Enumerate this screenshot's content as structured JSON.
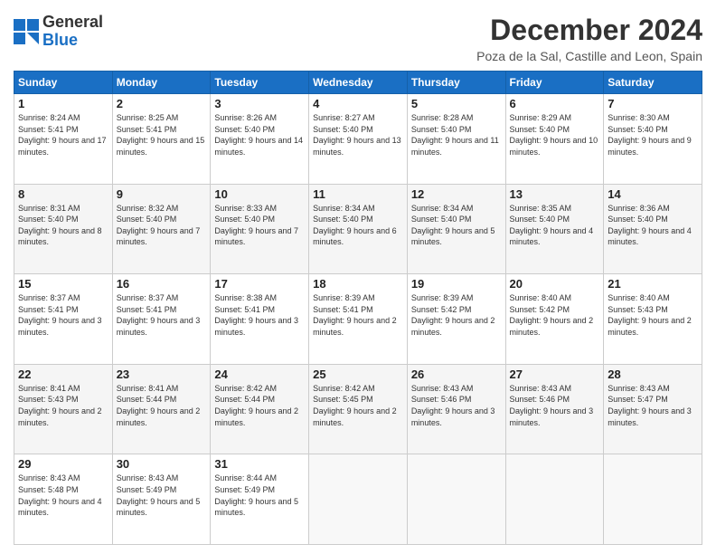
{
  "header": {
    "logo_line1": "General",
    "logo_line2": "Blue",
    "month": "December 2024",
    "location": "Poza de la Sal, Castille and Leon, Spain"
  },
  "days_of_week": [
    "Sunday",
    "Monday",
    "Tuesday",
    "Wednesday",
    "Thursday",
    "Friday",
    "Saturday"
  ],
  "weeks": [
    [
      {
        "day": "1",
        "info": "Sunrise: 8:24 AM\nSunset: 5:41 PM\nDaylight: 9 hours and 17 minutes."
      },
      {
        "day": "2",
        "info": "Sunrise: 8:25 AM\nSunset: 5:41 PM\nDaylight: 9 hours and 15 minutes."
      },
      {
        "day": "3",
        "info": "Sunrise: 8:26 AM\nSunset: 5:40 PM\nDaylight: 9 hours and 14 minutes."
      },
      {
        "day": "4",
        "info": "Sunrise: 8:27 AM\nSunset: 5:40 PM\nDaylight: 9 hours and 13 minutes."
      },
      {
        "day": "5",
        "info": "Sunrise: 8:28 AM\nSunset: 5:40 PM\nDaylight: 9 hours and 11 minutes."
      },
      {
        "day": "6",
        "info": "Sunrise: 8:29 AM\nSunset: 5:40 PM\nDaylight: 9 hours and 10 minutes."
      },
      {
        "day": "7",
        "info": "Sunrise: 8:30 AM\nSunset: 5:40 PM\nDaylight: 9 hours and 9 minutes."
      }
    ],
    [
      {
        "day": "8",
        "info": "Sunrise: 8:31 AM\nSunset: 5:40 PM\nDaylight: 9 hours and 8 minutes."
      },
      {
        "day": "9",
        "info": "Sunrise: 8:32 AM\nSunset: 5:40 PM\nDaylight: 9 hours and 7 minutes."
      },
      {
        "day": "10",
        "info": "Sunrise: 8:33 AM\nSunset: 5:40 PM\nDaylight: 9 hours and 7 minutes."
      },
      {
        "day": "11",
        "info": "Sunrise: 8:34 AM\nSunset: 5:40 PM\nDaylight: 9 hours and 6 minutes."
      },
      {
        "day": "12",
        "info": "Sunrise: 8:34 AM\nSunset: 5:40 PM\nDaylight: 9 hours and 5 minutes."
      },
      {
        "day": "13",
        "info": "Sunrise: 8:35 AM\nSunset: 5:40 PM\nDaylight: 9 hours and 4 minutes."
      },
      {
        "day": "14",
        "info": "Sunrise: 8:36 AM\nSunset: 5:40 PM\nDaylight: 9 hours and 4 minutes."
      }
    ],
    [
      {
        "day": "15",
        "info": "Sunrise: 8:37 AM\nSunset: 5:41 PM\nDaylight: 9 hours and 3 minutes."
      },
      {
        "day": "16",
        "info": "Sunrise: 8:37 AM\nSunset: 5:41 PM\nDaylight: 9 hours and 3 minutes."
      },
      {
        "day": "17",
        "info": "Sunrise: 8:38 AM\nSunset: 5:41 PM\nDaylight: 9 hours and 3 minutes."
      },
      {
        "day": "18",
        "info": "Sunrise: 8:39 AM\nSunset: 5:41 PM\nDaylight: 9 hours and 2 minutes."
      },
      {
        "day": "19",
        "info": "Sunrise: 8:39 AM\nSunset: 5:42 PM\nDaylight: 9 hours and 2 minutes."
      },
      {
        "day": "20",
        "info": "Sunrise: 8:40 AM\nSunset: 5:42 PM\nDaylight: 9 hours and 2 minutes."
      },
      {
        "day": "21",
        "info": "Sunrise: 8:40 AM\nSunset: 5:43 PM\nDaylight: 9 hours and 2 minutes."
      }
    ],
    [
      {
        "day": "22",
        "info": "Sunrise: 8:41 AM\nSunset: 5:43 PM\nDaylight: 9 hours and 2 minutes."
      },
      {
        "day": "23",
        "info": "Sunrise: 8:41 AM\nSunset: 5:44 PM\nDaylight: 9 hours and 2 minutes."
      },
      {
        "day": "24",
        "info": "Sunrise: 8:42 AM\nSunset: 5:44 PM\nDaylight: 9 hours and 2 minutes."
      },
      {
        "day": "25",
        "info": "Sunrise: 8:42 AM\nSunset: 5:45 PM\nDaylight: 9 hours and 2 minutes."
      },
      {
        "day": "26",
        "info": "Sunrise: 8:43 AM\nSunset: 5:46 PM\nDaylight: 9 hours and 3 minutes."
      },
      {
        "day": "27",
        "info": "Sunrise: 8:43 AM\nSunset: 5:46 PM\nDaylight: 9 hours and 3 minutes."
      },
      {
        "day": "28",
        "info": "Sunrise: 8:43 AM\nSunset: 5:47 PM\nDaylight: 9 hours and 3 minutes."
      }
    ],
    [
      {
        "day": "29",
        "info": "Sunrise: 8:43 AM\nSunset: 5:48 PM\nDaylight: 9 hours and 4 minutes."
      },
      {
        "day": "30",
        "info": "Sunrise: 8:43 AM\nSunset: 5:49 PM\nDaylight: 9 hours and 5 minutes."
      },
      {
        "day": "31",
        "info": "Sunrise: 8:44 AM\nSunset: 5:49 PM\nDaylight: 9 hours and 5 minutes."
      },
      null,
      null,
      null,
      null
    ]
  ]
}
